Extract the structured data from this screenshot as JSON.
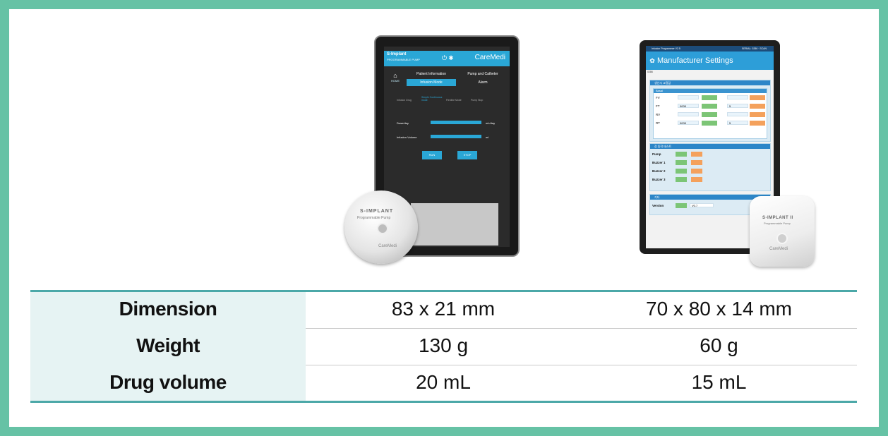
{
  "device1": {
    "brand": "S-Implant",
    "brand_sub": "PROGRAMMABLE PUMP",
    "logo": "CareMedi",
    "home_label": "HOME",
    "tabs": [
      "Patient Information",
      "Pump and Catheter",
      "Infusion Mode",
      "Alarm"
    ],
    "modes": [
      "Infusion Drug",
      "Simple Continuous mode",
      "Flexible Mode",
      "Pump Stop"
    ],
    "dose_label": "Dose/day",
    "dose_unit": "mL/day",
    "volume_label": "Infusion Volume",
    "volume_unit": "ml",
    "run_button": "RUN",
    "stop_button": "STOP",
    "pump_label": "S-IMPLANT",
    "pump_sub": "Programmable Pump",
    "pump_logo": "CareMedi"
  },
  "device2": {
    "status_left": "Infusion Programmer V2.5",
    "status_right": "SERIAL: 0286 · SCAN",
    "title": "Manufacturer Settings",
    "sub": "0286",
    "calibration_header": "생산시 교정값",
    "basal_header": "Basal",
    "calibration_rows": [
      {
        "label": "FV",
        "value": "",
        "value2": ""
      },
      {
        "label": "FT",
        "value": "0005",
        "value2": "5"
      },
      {
        "label": "RV",
        "value": "",
        "value2": ""
      },
      {
        "label": "RT",
        "value": "0005",
        "value2": "5"
      }
    ],
    "test_header": "장 동작 테스트",
    "test_rows": [
      "Pump",
      "Buzzer 1",
      "Buzzer 2",
      "Buzzer 3"
    ],
    "misc_header": "기타",
    "version_label": "Version",
    "version_value": "V0.7",
    "pump_label": "S-IMPLANT II",
    "pump_sub": "Programmable Pump",
    "pump_logo": "CareMedi"
  },
  "specs": {
    "rows": [
      {
        "label": "Dimension",
        "v1": "83 x 21 mm",
        "v2": "70 x 80 x 14 mm"
      },
      {
        "label": "Weight",
        "v1": "130 g",
        "v2": "60 g"
      },
      {
        "label": "Drug volume",
        "v1": "20 mL",
        "v2": "15 mL"
      }
    ]
  },
  "colors": {
    "frame": "#66c2a5",
    "table_rule": "#4ba8a8",
    "label_bg": "#e6f3f3",
    "accent": "#2aa7d6"
  }
}
